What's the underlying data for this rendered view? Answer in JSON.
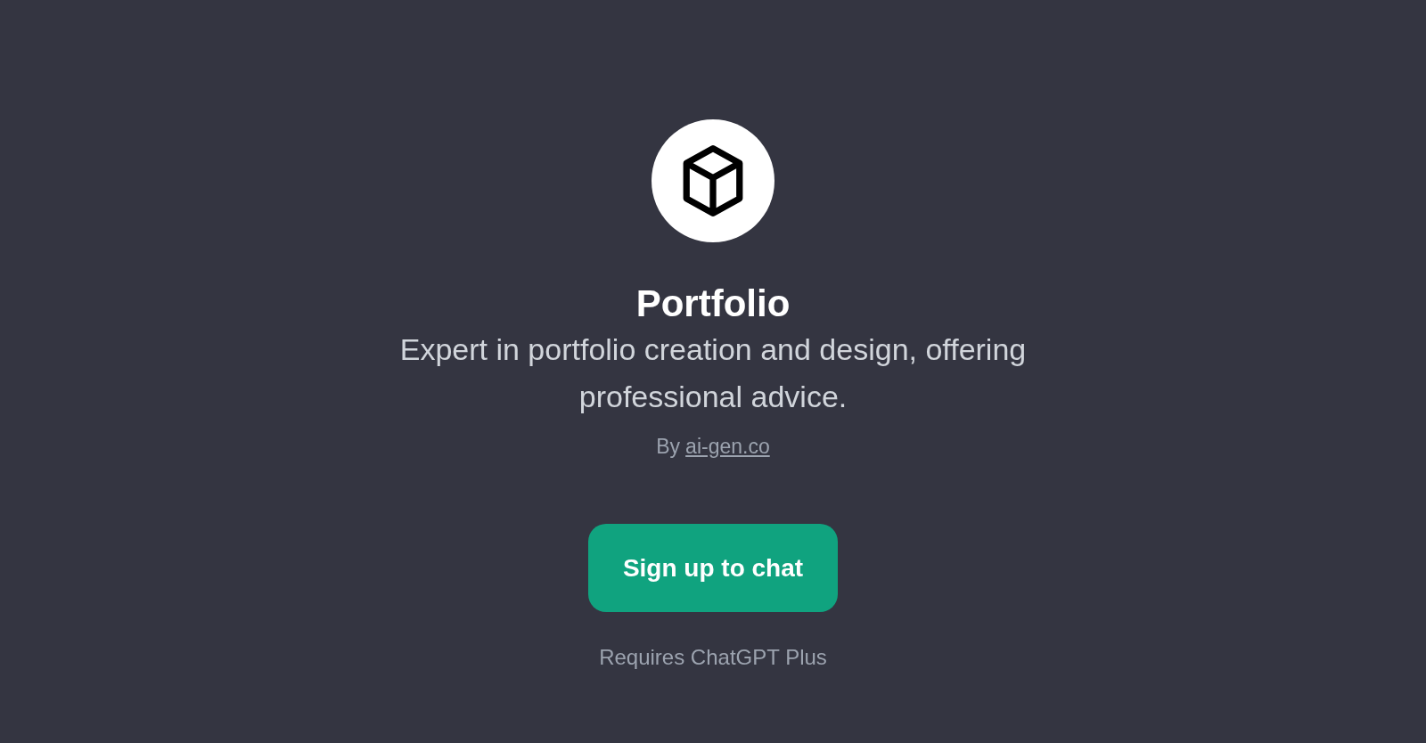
{
  "gpt": {
    "title": "Portfolio",
    "description": "Expert in portfolio creation and design, offering professional advice.",
    "byline": {
      "prefix": "By",
      "link": "ai-gen.co"
    }
  },
  "action": {
    "label": "Sign up to chat"
  },
  "note": "Requires ChatGPT Plus"
}
